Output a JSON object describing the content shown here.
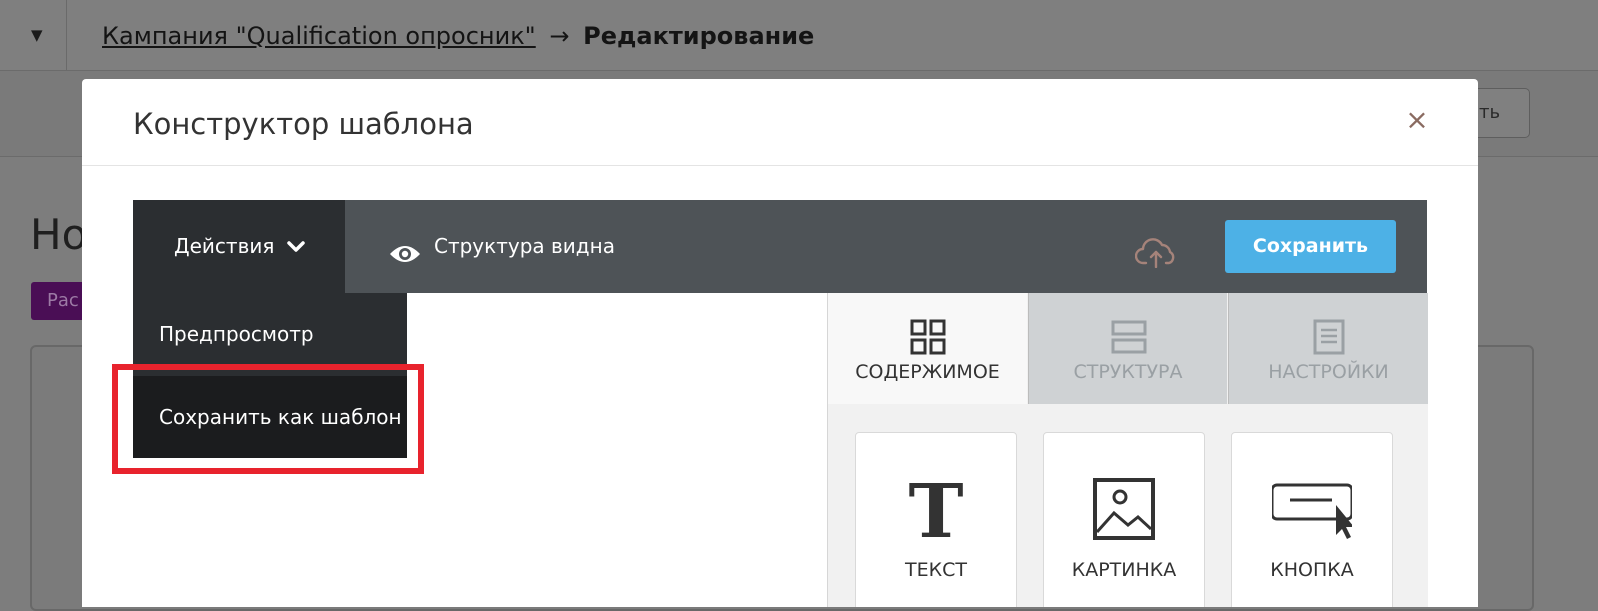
{
  "breadcrumb": {
    "campaign_link": "Кампания \"Qualification опросник\"",
    "separator": "→",
    "current": "Редактирование"
  },
  "background": {
    "collapse_arrow": "▼",
    "heading": "Но",
    "badge": "Рас",
    "button_label": "ть"
  },
  "modal": {
    "title": "Конструктор шаблона",
    "close_glyph": "×"
  },
  "toolbar": {
    "actions_label": "Действия",
    "structure_visible": "Структура видна",
    "save_label": "Сохранить"
  },
  "actions_menu": {
    "items": [
      "Предпросмотр",
      "Сохранить как шаблон"
    ]
  },
  "side_panel": {
    "tabs": [
      "СОДЕРЖИМОЕ",
      "СТРУКТУРА",
      "НАСТРОЙКИ"
    ],
    "active_tab": "СОДЕРЖИМОЕ",
    "blocks": [
      "ТЕКСТ",
      "КАРТИНКА",
      "КНОПКА"
    ]
  },
  "colors": {
    "accent_save": "#4db1e6",
    "highlight": "#e8232d",
    "toolbar_bg": "#4e5357",
    "dropdown_bg": "#2b2e31",
    "badge_bg": "#4a0e55"
  },
  "icons": {
    "collapse": "triangle-down-icon",
    "close": "close-icon",
    "actions": "chevron-down-icon",
    "structure": "eye-icon",
    "upload": "cloud-upload-icon",
    "tab_content": "grid-icon",
    "tab_structure": "rows-icon",
    "tab_settings": "document-icon",
    "block_text": "letter-t-icon",
    "block_image": "image-icon",
    "block_button": "button-cursor-icon"
  }
}
